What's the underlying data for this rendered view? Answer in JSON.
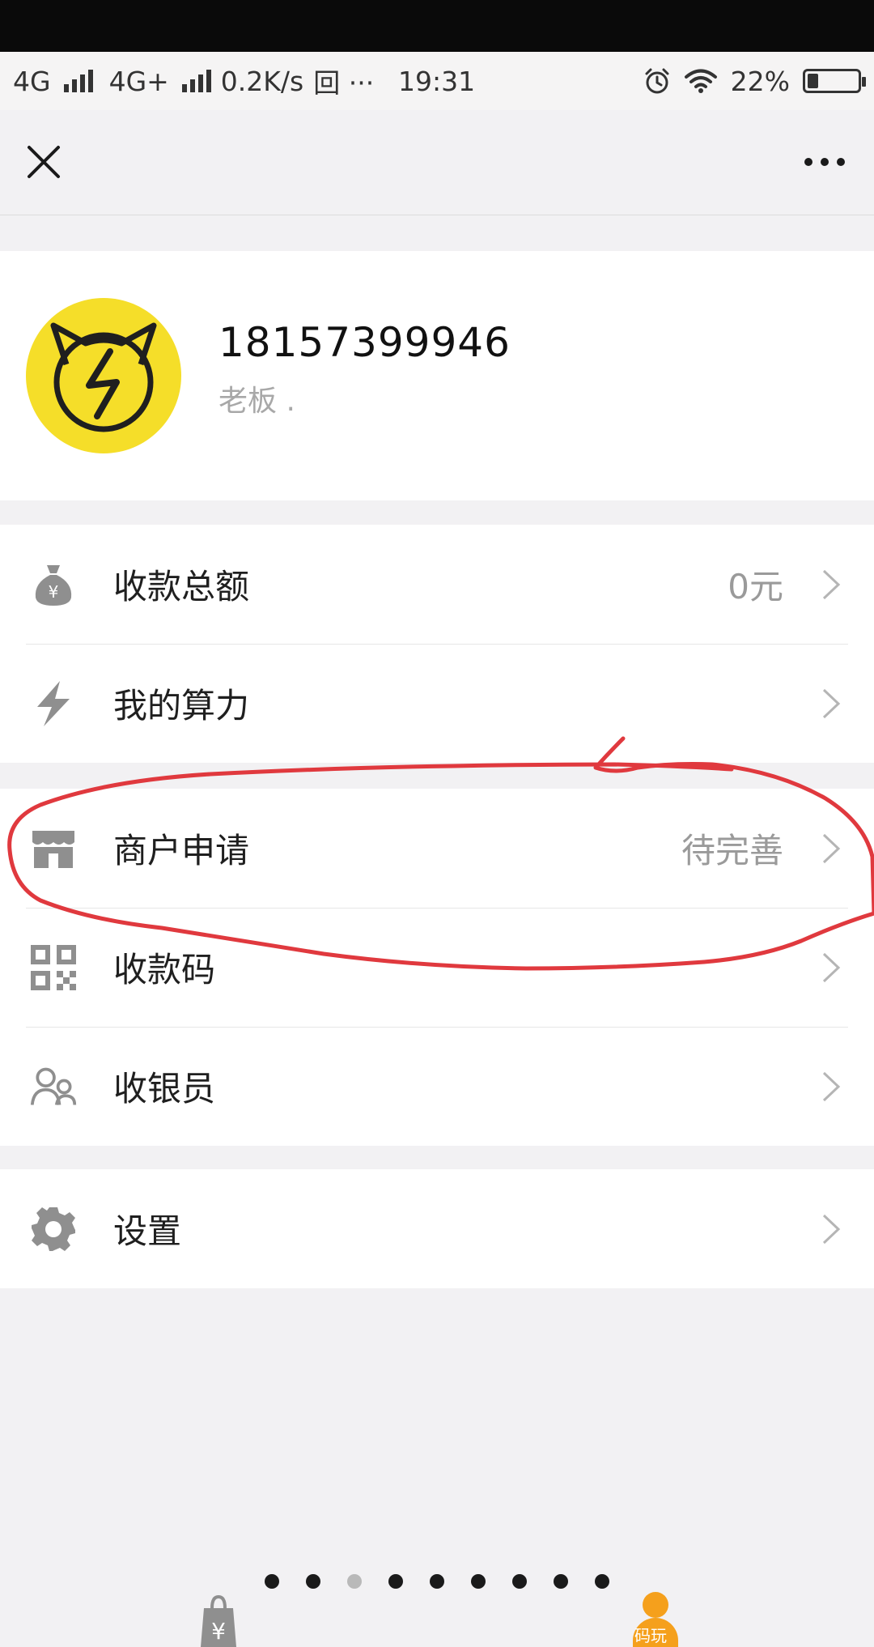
{
  "status_bar": {
    "network_1": "4G",
    "network_2": "4G+",
    "speed": "0.2K/s",
    "extra_icons": "回 ···",
    "time": "19:31",
    "battery": "22%",
    "battery_level": 0.22
  },
  "navbar": {
    "close_icon": "close-icon",
    "more_icon": "more-icon"
  },
  "profile": {
    "phone": "18157399946",
    "role": "老板 ."
  },
  "menu": {
    "group1": [
      {
        "label": "收款总额",
        "value": "0元",
        "icon": "money-bag-icon"
      },
      {
        "label": "我的算力",
        "value": "",
        "icon": "lightning-icon"
      }
    ],
    "group2": [
      {
        "label": "商户申请",
        "value": "待完善",
        "icon": "shop-icon"
      },
      {
        "label": "收款码",
        "value": "",
        "icon": "qr-code-icon"
      },
      {
        "label": "收银员",
        "value": "",
        "icon": "cashier-icon"
      }
    ],
    "group3": [
      {
        "label": "设置",
        "value": "",
        "icon": "gear-icon"
      }
    ]
  },
  "bottom": {
    "page_count": 9,
    "active_page": 3,
    "right_tab_text": "码玩"
  },
  "colors": {
    "annotation": "#e0393e",
    "avatar_bg": "#f5de29",
    "accent": "#f5a01c"
  }
}
